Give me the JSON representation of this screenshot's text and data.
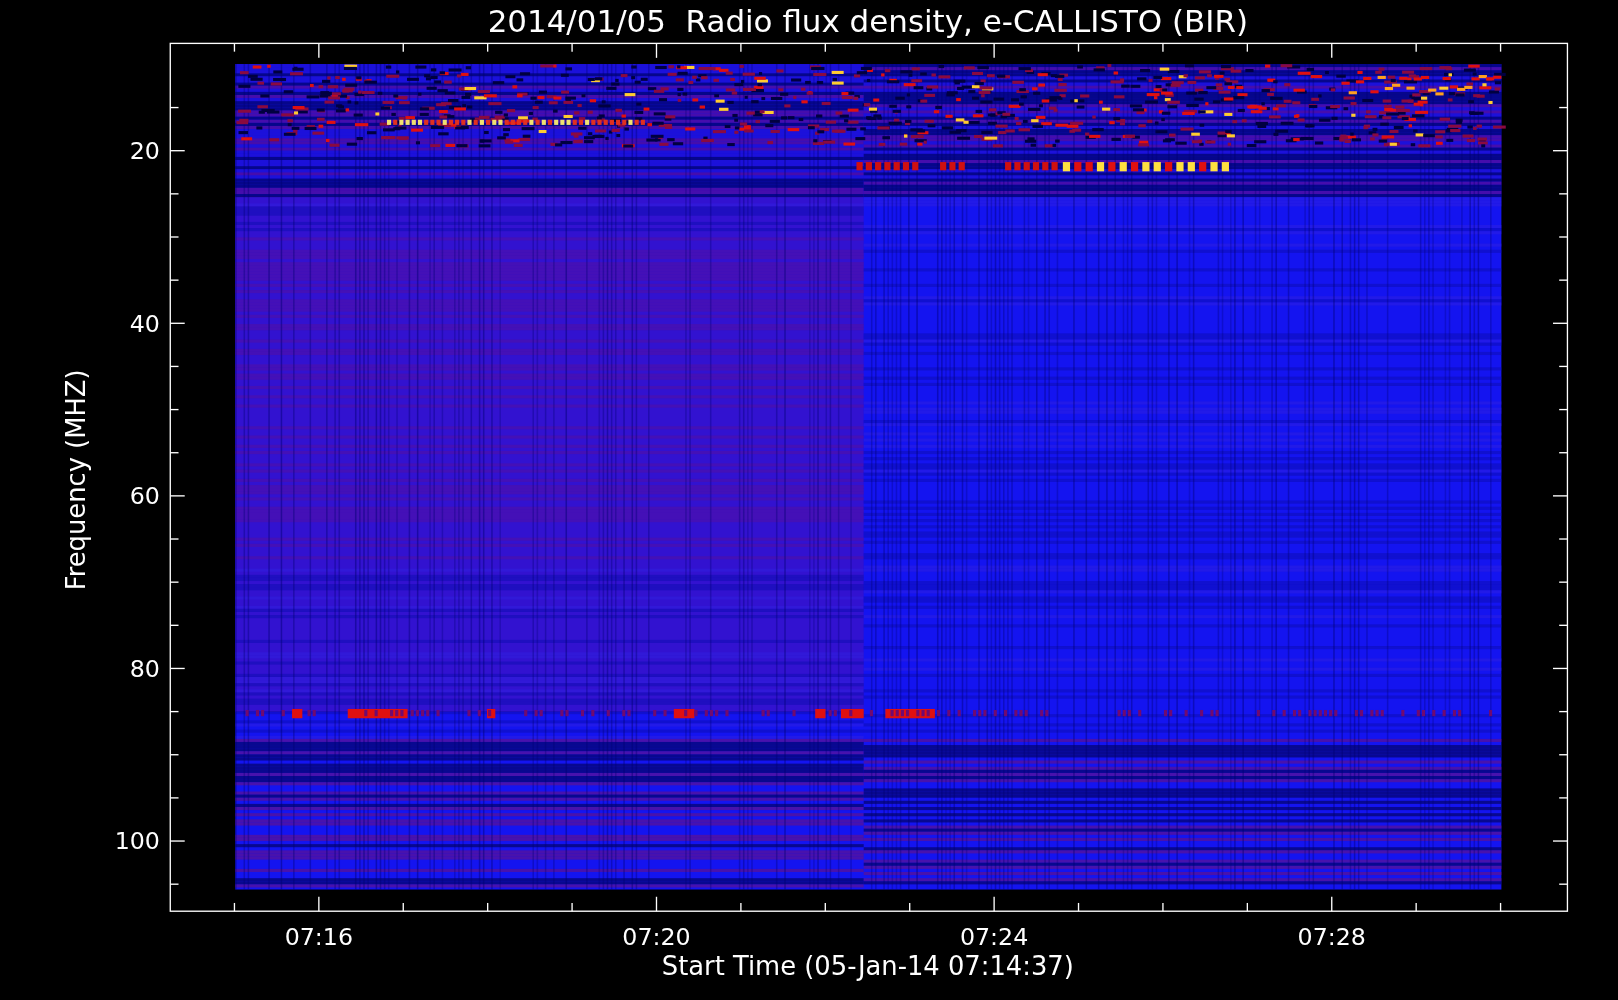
{
  "plot": {
    "title": "2014/01/05  Radio flux density, e-CALLISTO (BIR)",
    "xlabel": "Start Time (05-Jan-14 07:14:37)",
    "ylabel": "Frequency (MHZ)",
    "xticks": [
      "07:16",
      "07:20",
      "07:24",
      "07:28"
    ],
    "yticks": [
      "20",
      "40",
      "60",
      "80",
      "100"
    ]
  }
}
